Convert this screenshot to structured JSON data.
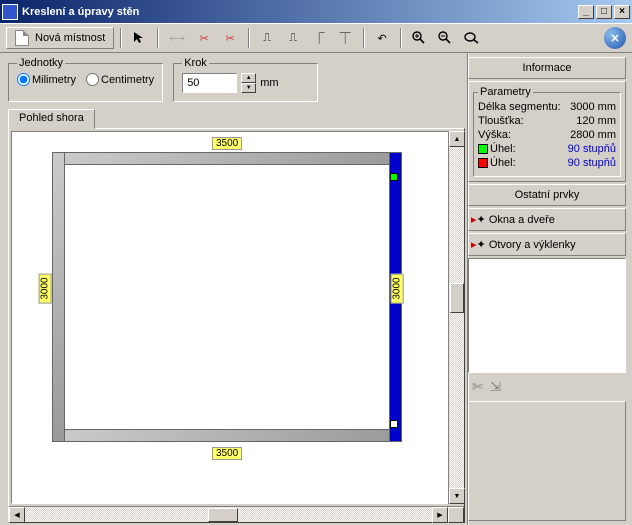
{
  "title": "Kreslení a úpravy stěn",
  "toolbar": {
    "new_room": "Nová místnost"
  },
  "units": {
    "legend": "Jednotky",
    "mm": "Milimetry",
    "cm": "Centimetry",
    "selected": "mm"
  },
  "step": {
    "legend": "Krok",
    "value": "50",
    "unit": "mm"
  },
  "tabs": {
    "top_view": "Pohled shora"
  },
  "dimensions": {
    "top": "3500",
    "bottom": "3500",
    "left": "3000",
    "right": "3000"
  },
  "info": {
    "header": "Informace",
    "params_legend": "Parametry",
    "segment_length_label": "Délka segmentu:",
    "segment_length": "3000 mm",
    "thickness_label": "Tloušťka:",
    "thickness": "120 mm",
    "height_label": "Výška:",
    "height": "2800 mm",
    "angle_label": "Úhel:",
    "angle1": "90 stupňů",
    "angle2": "90 stupňů"
  },
  "other": {
    "header": "Ostatní prvky",
    "windows_doors": "Okna a dveře",
    "openings": "Otvory a výklenky"
  }
}
